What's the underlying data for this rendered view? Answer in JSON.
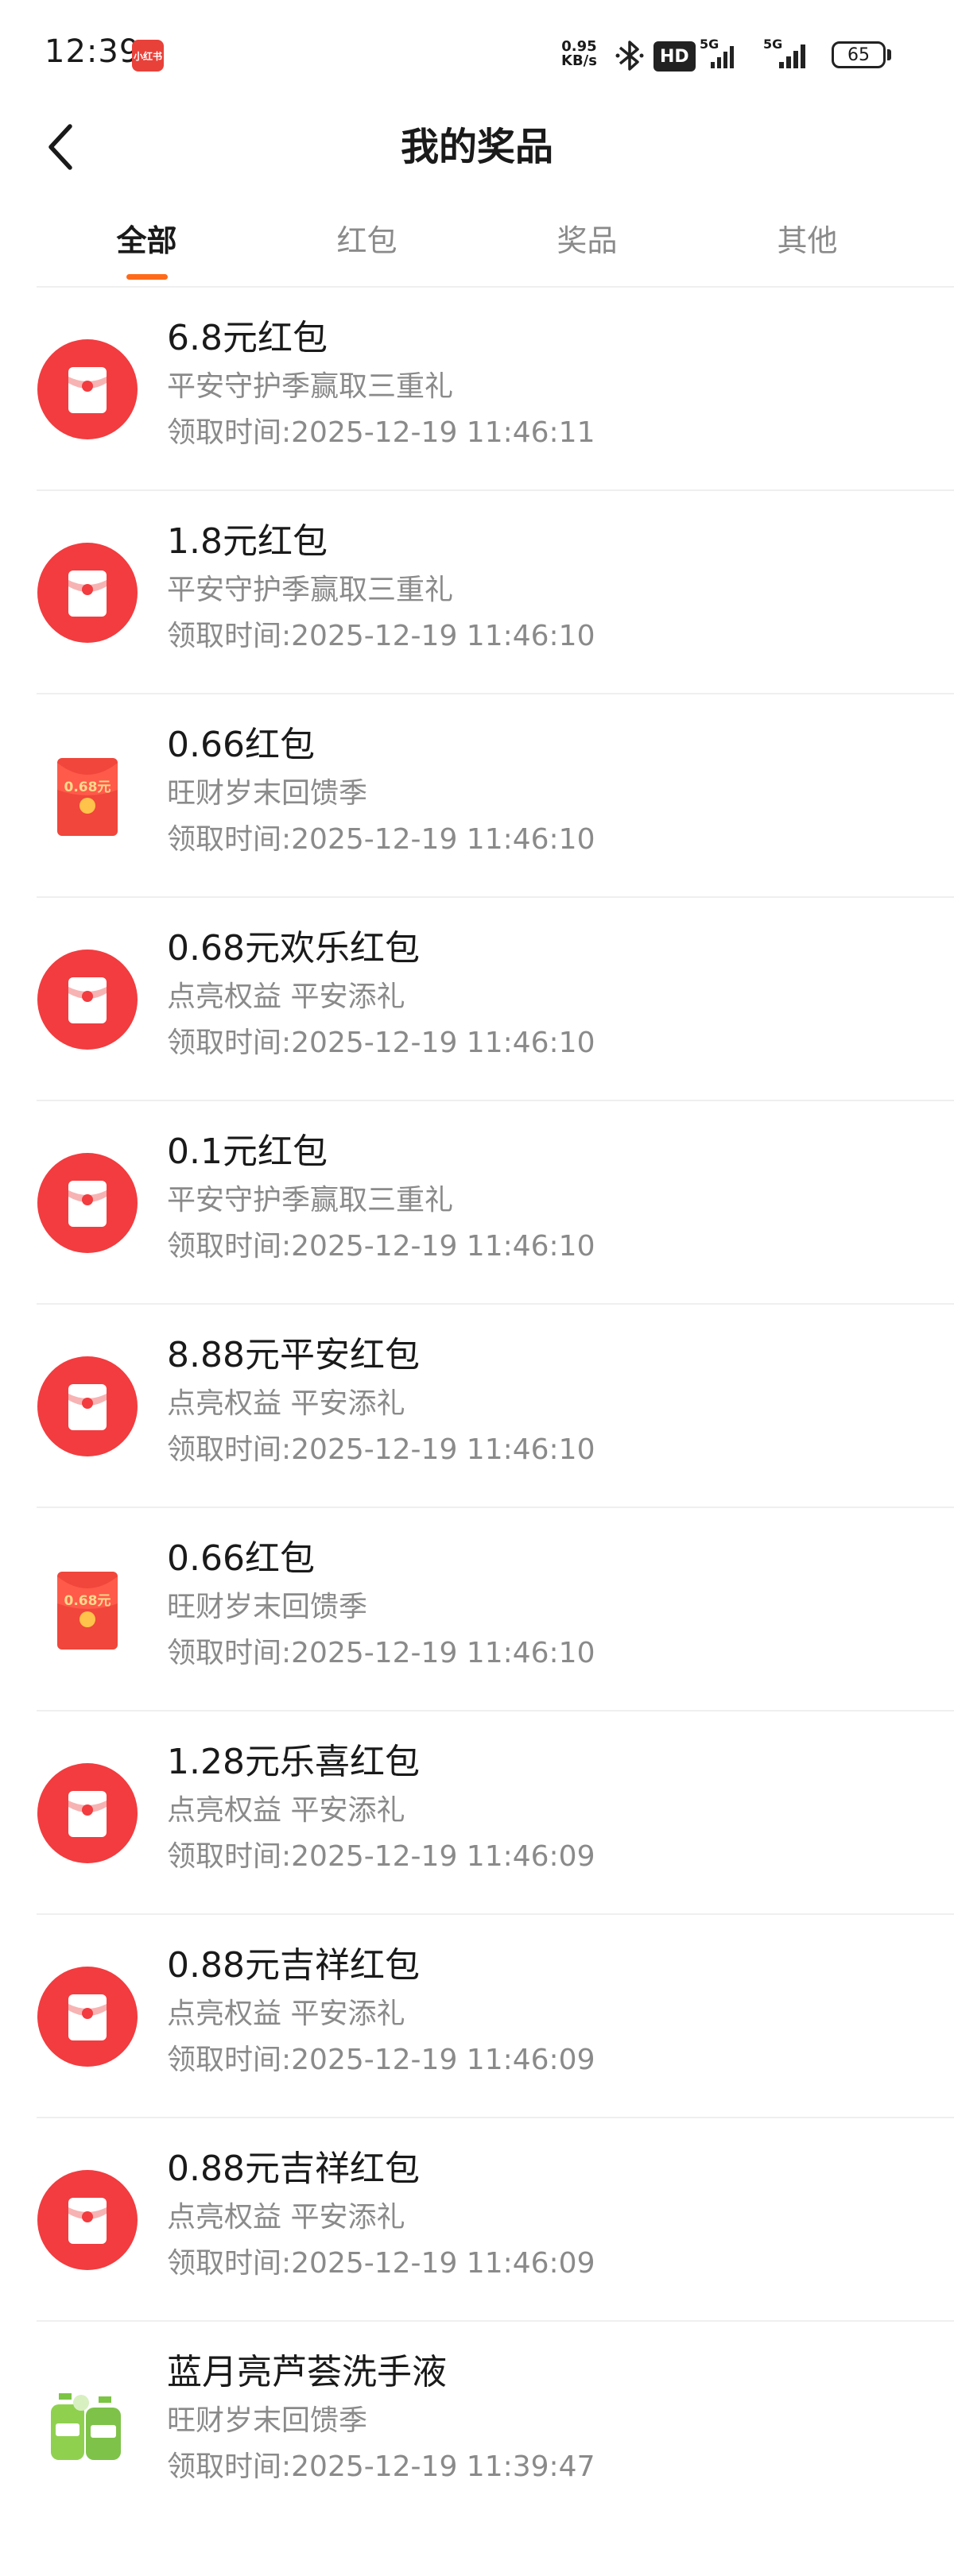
{
  "status_bar": {
    "time": "12:39",
    "app_badge": "小红书",
    "net_speed_value": "0.95",
    "net_speed_unit": "KB/s",
    "hd_label": "HD",
    "sim1_label": "5G",
    "sim2_label": "5G",
    "battery": "65"
  },
  "header": {
    "title": "我的奖品"
  },
  "tabs": [
    {
      "label": "全部",
      "active": true
    },
    {
      "label": "红包",
      "active": false
    },
    {
      "label": "奖品",
      "active": false
    },
    {
      "label": "其他",
      "active": false
    }
  ],
  "accent_color": "#ff6a1a",
  "red_packet_color": "#f23c3f",
  "items": [
    {
      "icon": "red-packet-circle-icon",
      "title": "6.8元红包",
      "subtitle": "平安守护季赢取三重礼",
      "time": "领取时间:2025-12-19 11:46:11"
    },
    {
      "icon": "red-packet-circle-icon",
      "title": "1.8元红包",
      "subtitle": "平安守护季赢取三重礼",
      "time": "领取时间:2025-12-19 11:46:10"
    },
    {
      "icon": "red-envelope-card-icon",
      "icon_text": "0.68元",
      "title": "0.66红包",
      "subtitle": "旺财岁末回馈季",
      "time": "领取时间:2025-12-19 11:46:10"
    },
    {
      "icon": "red-packet-circle-icon",
      "title": "0.68元欢乐红包",
      "subtitle": "点亮权益 平安添礼",
      "time": "领取时间:2025-12-19 11:46:10"
    },
    {
      "icon": "red-packet-circle-icon",
      "title": "0.1元红包",
      "subtitle": "平安守护季赢取三重礼",
      "time": "领取时间:2025-12-19 11:46:10"
    },
    {
      "icon": "red-packet-circle-icon",
      "title": "8.88元平安红包",
      "subtitle": "点亮权益 平安添礼",
      "time": "领取时间:2025-12-19 11:46:10"
    },
    {
      "icon": "red-envelope-card-icon",
      "icon_text": "0.68元",
      "title": "0.66红包",
      "subtitle": "旺财岁末回馈季",
      "time": "领取时间:2025-12-19 11:46:10"
    },
    {
      "icon": "red-packet-circle-icon",
      "title": "1.28元乐喜红包",
      "subtitle": "点亮权益 平安添礼",
      "time": "领取时间:2025-12-19 11:46:09"
    },
    {
      "icon": "red-packet-circle-icon",
      "title": "0.88元吉祥红包",
      "subtitle": "点亮权益 平安添礼",
      "time": "领取时间:2025-12-19 11:46:09"
    },
    {
      "icon": "red-packet-circle-icon",
      "title": "0.88元吉祥红包",
      "subtitle": "点亮权益 平安添礼",
      "time": "领取时间:2025-12-19 11:46:09"
    },
    {
      "icon": "hand-soap-product-icon",
      "title": "蓝月亮芦荟洗手液",
      "subtitle": "旺财岁末回馈季",
      "time": "领取时间:2025-12-19 11:39:47"
    }
  ]
}
